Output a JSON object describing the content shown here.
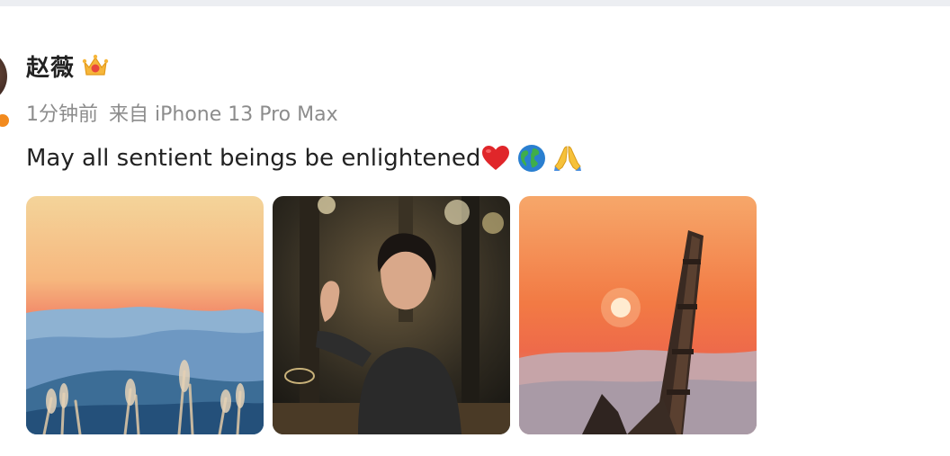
{
  "post": {
    "username": "赵薇",
    "badge_icon": "crown-vip-icon",
    "timestamp": "1分钟前",
    "source": "来自 iPhone 13 Pro Max",
    "text": "May all sentient beings be enlightened",
    "emojis": [
      "red-heart-icon",
      "globe-icon",
      "folded-hands-icon"
    ],
    "images": [
      {
        "name": "sunset-mountains-reeds"
      },
      {
        "name": "woman-smiling-cafe"
      },
      {
        "name": "orange-sun-tower"
      }
    ]
  },
  "colors": {
    "text": "#222222",
    "meta": "#8c8c8c",
    "badge": "#f28a1e"
  }
}
